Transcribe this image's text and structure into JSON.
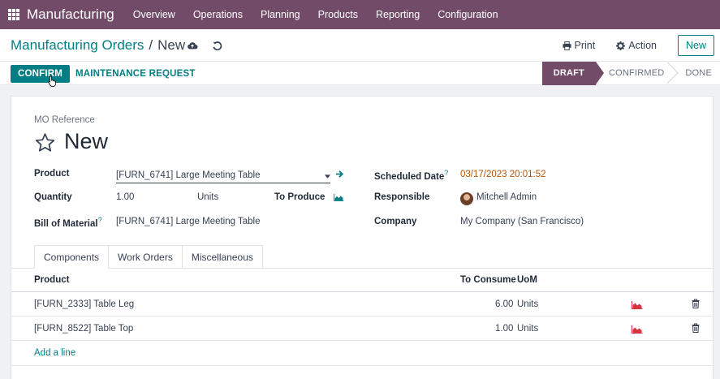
{
  "navbar": {
    "app_name": "Manufacturing",
    "menu": [
      "Overview",
      "Operations",
      "Planning",
      "Products",
      "Reporting",
      "Configuration"
    ]
  },
  "control_panel": {
    "breadcrumb_parent": "Manufacturing Orders",
    "breadcrumb_sep": "/",
    "breadcrumb_current": "New",
    "print_label": "Print",
    "action_label": "Action",
    "new_label": "New"
  },
  "statusbar": {
    "confirm_label": "CONFIRM",
    "maintenance_label": "MAINTENANCE REQUEST",
    "stages": [
      "DRAFT",
      "CONFIRMED",
      "DONE"
    ],
    "active_stage": "DRAFT"
  },
  "form": {
    "mo_reference_label": "MO Reference",
    "title": "New",
    "product_label": "Product",
    "product_value": "[FURN_6741] Large Meeting Table",
    "quantity_label": "Quantity",
    "quantity_value": "1.00",
    "quantity_uom": "Units",
    "to_produce_label": "To Produce",
    "bom_label": "Bill of Material",
    "bom_value": "[FURN_6741] Large Meeting Table",
    "scheduled_date_label": "Scheduled Date",
    "scheduled_date_value": "03/17/2023 20:01:52",
    "responsible_label": "Responsible",
    "responsible_value": "Mitchell Admin",
    "company_label": "Company",
    "company_value": "My Company (San Francisco)",
    "help_marker": "?"
  },
  "tabs": [
    "Components",
    "Work Orders",
    "Miscellaneous"
  ],
  "components_table": {
    "headers": {
      "product": "Product",
      "to_consume": "To Consume",
      "uom": "UoM"
    },
    "rows": [
      {
        "product": "[FURN_2333] Table Leg",
        "to_consume": "6.00",
        "uom": "Units"
      },
      {
        "product": "[FURN_8522] Table Top",
        "to_consume": "1.00",
        "uom": "Units"
      }
    ],
    "add_line_label": "Add a line"
  },
  "colors": {
    "brand": "#714b67",
    "accent": "#017e84",
    "date": "#b45309",
    "forecast_red": "#d9333f"
  }
}
